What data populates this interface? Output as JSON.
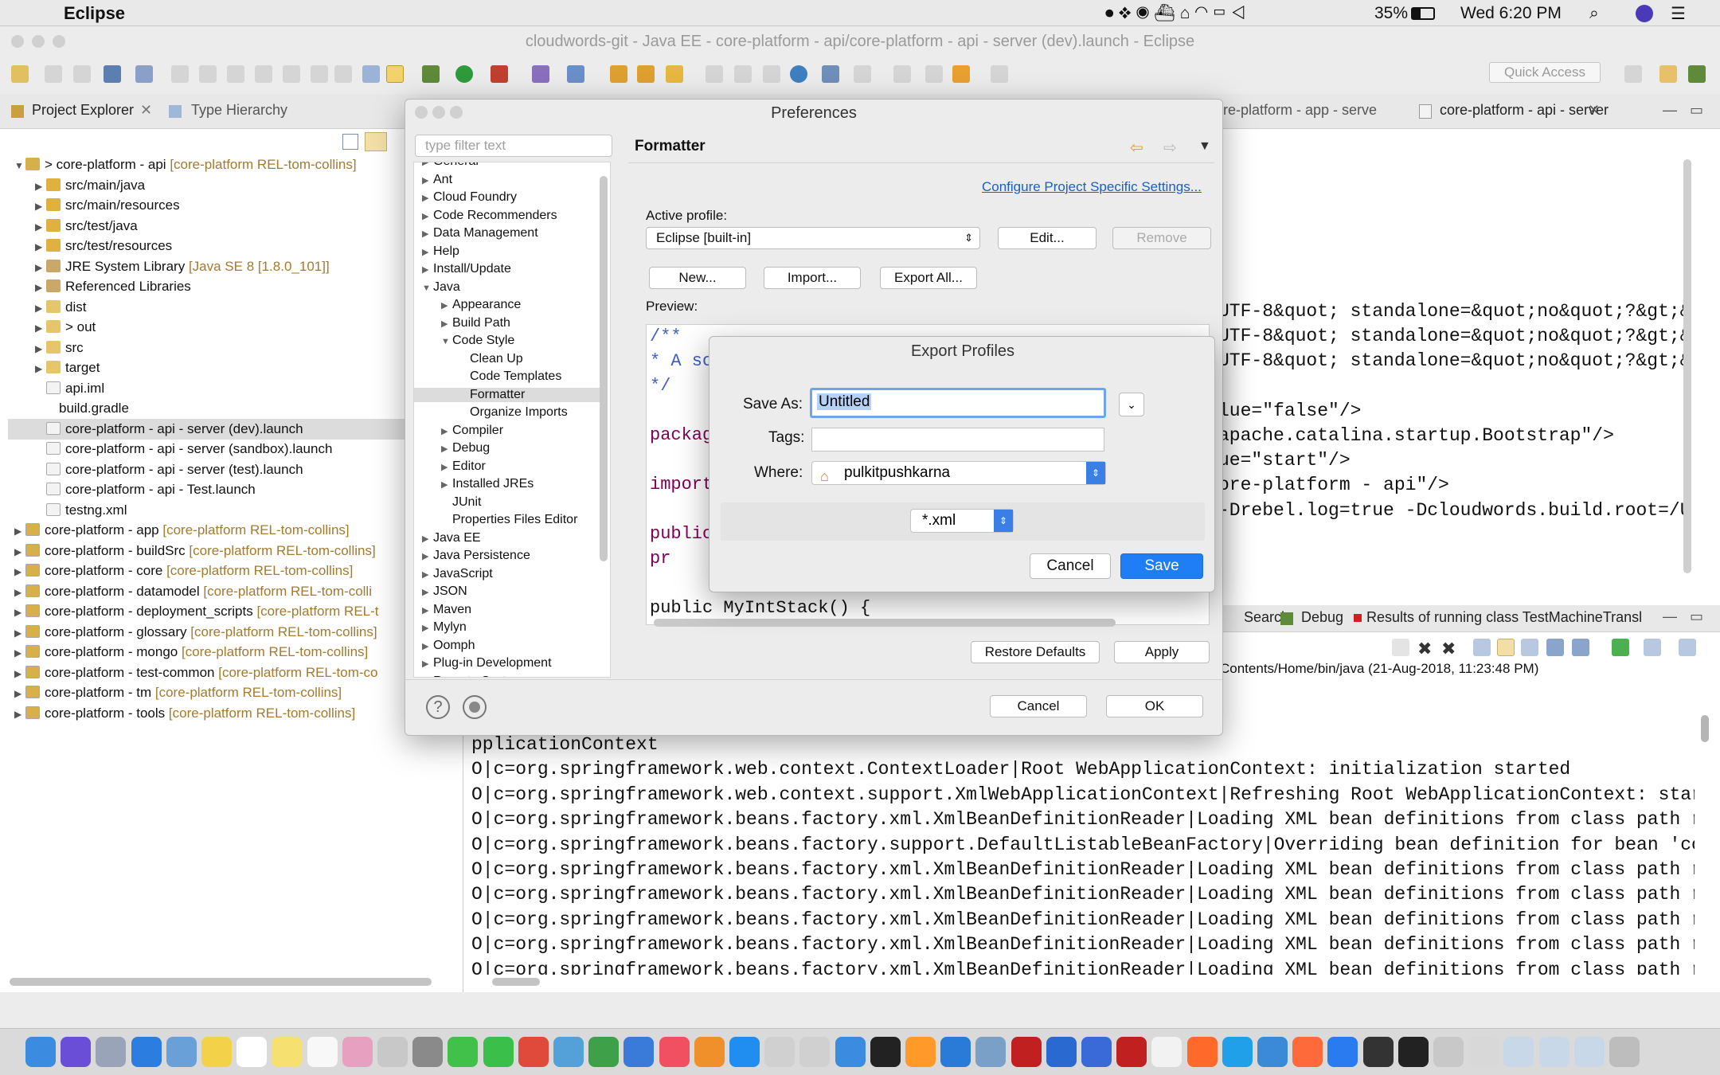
{
  "menubar": {
    "app": "Eclipse",
    "battery": "35%",
    "clock": "Wed 6:20 PM"
  },
  "window": {
    "title": "cloudwords-git - Java EE - core-platform - api/core-platform - api - server (dev).launch - Eclipse"
  },
  "quick_access": "Quick Access",
  "left_tabs": {
    "explorer": "Project Explorer",
    "hierarchy": "Type Hierarchy"
  },
  "tree": [
    {
      "t": "> core-platform - api",
      "d": "[core-platform REL-tom-collins]"
    },
    {
      "t": "src/main/java",
      "d": ""
    },
    {
      "t": "src/main/resources",
      "d": ""
    },
    {
      "t": "src/test/java",
      "d": ""
    },
    {
      "t": "src/test/resources",
      "d": ""
    },
    {
      "t": "JRE System Library",
      "d": "[Java SE 8 [1.8.0_101]]"
    },
    {
      "t": "Referenced Libraries",
      "d": ""
    },
    {
      "t": "dist",
      "d": ""
    },
    {
      "t": "> out",
      "d": ""
    },
    {
      "t": "src",
      "d": ""
    },
    {
      "t": "target",
      "d": ""
    },
    {
      "t": "api.iml",
      "d": ""
    },
    {
      "t": "build.gradle",
      "d": ""
    },
    {
      "t": "core-platform - api - server (dev).launch",
      "d": ""
    },
    {
      "t": "core-platform - api - server (sandbox).launch",
      "d": ""
    },
    {
      "t": "core-platform - api - server (test).launch",
      "d": ""
    },
    {
      "t": "core-platform - api - Test.launch",
      "d": ""
    },
    {
      "t": "testng.xml",
      "d": ""
    },
    {
      "t": "core-platform - app",
      "d": "[core-platform REL-tom-collins]"
    },
    {
      "t": "core-platform - buildSrc",
      "d": "[core-platform REL-tom-collins]"
    },
    {
      "t": "core-platform - core",
      "d": "[core-platform REL-tom-collins]"
    },
    {
      "t": "core-platform - datamodel",
      "d": "[core-platform REL-tom-colli"
    },
    {
      "t": "core-platform - deployment_scripts",
      "d": "[core-platform REL-t"
    },
    {
      "t": "core-platform - glossary",
      "d": "[core-platform REL-tom-collins]"
    },
    {
      "t": "core-platform - mongo",
      "d": "[core-platform REL-tom-collins]"
    },
    {
      "t": "core-platform - test-common",
      "d": "[core-platform REL-tom-co"
    },
    {
      "t": "core-platform - tm",
      "d": "[core-platform REL-tom-collins]"
    },
    {
      "t": "core-platform - tools",
      "d": "[core-platform REL-tom-collins]"
    }
  ],
  "editor": {
    "tab1": "re-platform - app - serve",
    "tab2": "core-platform - api - server",
    "lines": [
      "UTF-8&quot; standalone=&quot;no&quot;?&gt;&",
      "UTF-8&quot; standalone=&quot;no&quot;?&gt;&",
      "UTF-8&quot; standalone=&quot;no&quot;?&gt;&",
      "lue=\"false\"/>",
      "apache.catalina.startup.Bootstrap\"/>",
      "ue=\"start\"/>",
      "ore-platform - api\"/>",
      "-Drebel.log=true -Dcloudwords.build.root=/U"
    ]
  },
  "console": {
    "tabs": {
      "search": "Search",
      "debug": "Debug",
      "results": "Results of running class TestMachineTransl"
    },
    "path": "Contents/Home/bin/java (21-Aug-2018, 11:23:48 PM)",
    "lines": [
      "pplicationContext",
      "O|c=org.springframework.web.context.ContextLoader|Root WebApplicationContext: initialization started",
      "O|c=org.springframework.web.context.support.XmlWebApplicationContext|Refreshing Root WebApplicationContext: startu",
      "O|c=org.springframework.beans.factory.xml.XmlBeanDefinitionReader|Loading XML bean definitions from class path res",
      "O|c=org.springframework.beans.factory.support.DefaultListableBeanFactory|Overriding bean definition for bean 'cont",
      "O|c=org.springframework.beans.factory.xml.XmlBeanDefinitionReader|Loading XML bean definitions from class path res",
      "O|c=org.springframework.beans.factory.xml.XmlBeanDefinitionReader|Loading XML bean definitions from class path res",
      "O|c=org.springframework.beans.factory.xml.XmlBeanDefinitionReader|Loading XML bean definitions from class path res",
      "O|c=org.springframework.beans.factory.xml.XmlBeanDefinitionReader|Loading XML bean definitions from class path res",
      "O|c=org.springframework.beans.factory.xml.XmlBeanDefinitionReader|Loading XML bean definitions from class path res"
    ]
  },
  "prefs": {
    "title": "Preferences",
    "filter_placeholder": "type filter text",
    "tree": [
      {
        "t": "General",
        "l": 0,
        "e": "c"
      },
      {
        "t": "Ant",
        "l": 0,
        "e": "c"
      },
      {
        "t": "Cloud Foundry",
        "l": 0,
        "e": "c"
      },
      {
        "t": "Code Recommenders",
        "l": 0,
        "e": "c"
      },
      {
        "t": "Data Management",
        "l": 0,
        "e": "c"
      },
      {
        "t": "Help",
        "l": 0,
        "e": "c"
      },
      {
        "t": "Install/Update",
        "l": 0,
        "e": "c"
      },
      {
        "t": "Java",
        "l": 0,
        "e": "o"
      },
      {
        "t": "Appearance",
        "l": 1,
        "e": "c"
      },
      {
        "t": "Build Path",
        "l": 1,
        "e": "c"
      },
      {
        "t": "Code Style",
        "l": 1,
        "e": "o"
      },
      {
        "t": "Clean Up",
        "l": 2,
        "e": ""
      },
      {
        "t": "Code Templates",
        "l": 2,
        "e": ""
      },
      {
        "t": "Formatter",
        "l": 2,
        "e": ""
      },
      {
        "t": "Organize Imports",
        "l": 2,
        "e": ""
      },
      {
        "t": "Compiler",
        "l": 1,
        "e": "c"
      },
      {
        "t": "Debug",
        "l": 1,
        "e": "c"
      },
      {
        "t": "Editor",
        "l": 1,
        "e": "c"
      },
      {
        "t": "Installed JREs",
        "l": 1,
        "e": "c"
      },
      {
        "t": "JUnit",
        "l": 1,
        "e": ""
      },
      {
        "t": "Properties Files Editor",
        "l": 1,
        "e": ""
      },
      {
        "t": "Java EE",
        "l": 0,
        "e": "c"
      },
      {
        "t": "Java Persistence",
        "l": 0,
        "e": "c"
      },
      {
        "t": "JavaScript",
        "l": 0,
        "e": "c"
      },
      {
        "t": "JSON",
        "l": 0,
        "e": "c"
      },
      {
        "t": "Maven",
        "l": 0,
        "e": "c"
      },
      {
        "t": "Mylyn",
        "l": 0,
        "e": "c"
      },
      {
        "t": "Oomph",
        "l": 0,
        "e": "c"
      },
      {
        "t": "Plug-in Development",
        "l": 0,
        "e": "c"
      },
      {
        "t": "Remote Systems",
        "l": 0,
        "e": "c"
      }
    ],
    "section": "Formatter",
    "configure_link": "Configure Project Specific Settings...",
    "active_profile_label": "Active profile:",
    "profile_value": "Eclipse [built-in]",
    "edit": "Edit...",
    "remove": "Remove",
    "new": "New...",
    "import": "Import...",
    "export_all": "Export All...",
    "preview_label": "Preview:",
    "preview_lines": [
      "/**",
      "* A sc",
      "*/",
      "",
      "packag",
      "",
      "import",
      "",
      "public",
      "    pr",
      "",
      "    public MyIntStack() {"
    ],
    "restore": "Restore Defaults",
    "apply": "Apply",
    "cancel": "Cancel",
    "ok": "OK"
  },
  "export": {
    "title": "Export Profiles",
    "save_as_label": "Save As:",
    "save_as_value": "Untitled",
    "tags_label": "Tags:",
    "where_label": "Where:",
    "where_value": "pulkitpushkarna",
    "format": "*.xml",
    "cancel": "Cancel",
    "save": "Save"
  },
  "colors": {
    "accent": "#1f7ef6",
    "link": "#1a5fc9",
    "decorator": "#a37a2e"
  }
}
